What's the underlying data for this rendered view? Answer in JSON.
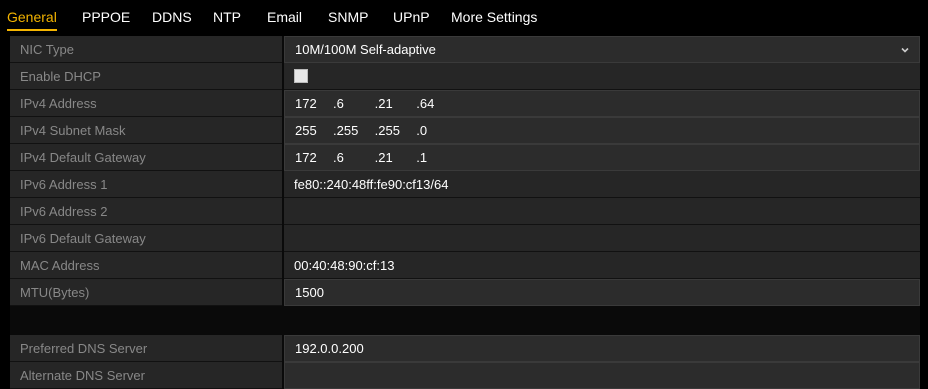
{
  "tabs": [
    {
      "label": "General",
      "active": true
    },
    {
      "label": "PPPOE",
      "active": false
    },
    {
      "label": "DDNS",
      "active": false
    },
    {
      "label": "NTP",
      "active": false
    },
    {
      "label": "Email",
      "active": false
    },
    {
      "label": "SNMP",
      "active": false
    },
    {
      "label": "UPnP",
      "active": false
    },
    {
      "label": "More Settings",
      "active": false
    }
  ],
  "fields": {
    "nic_type": {
      "label": "NIC Type",
      "value": "10M/100M Self-adaptive"
    },
    "enable_dhcp": {
      "label": "Enable DHCP",
      "checked": false
    },
    "ipv4_address": {
      "label": "IPv4 Address",
      "octets": [
        "172",
        "6",
        "21",
        "64"
      ]
    },
    "ipv4_subnet": {
      "label": "IPv4 Subnet Mask",
      "octets": [
        "255",
        "255",
        "255",
        "0"
      ]
    },
    "ipv4_gateway": {
      "label": "IPv4 Default Gateway",
      "octets": [
        "172",
        "6",
        "21",
        "1"
      ]
    },
    "ipv6_address_1": {
      "label": "IPv6 Address 1",
      "value": "fe80::240:48ff:fe90:cf13/64"
    },
    "ipv6_address_2": {
      "label": "IPv6 Address 2",
      "value": ""
    },
    "ipv6_gateway": {
      "label": "IPv6 Default Gateway",
      "value": ""
    },
    "mac_address": {
      "label": "MAC Address",
      "value": "00:40:48:90:cf:13"
    },
    "mtu": {
      "label": "MTU(Bytes)",
      "value": "1500"
    },
    "preferred_dns": {
      "label": "Preferred DNS Server",
      "value": "192.0.0.200"
    },
    "alternate_dns": {
      "label": "Alternate DNS Server",
      "value": ""
    }
  },
  "colors": {
    "active_tab": "#f4b400",
    "background": "#000000",
    "row": "#262626"
  }
}
